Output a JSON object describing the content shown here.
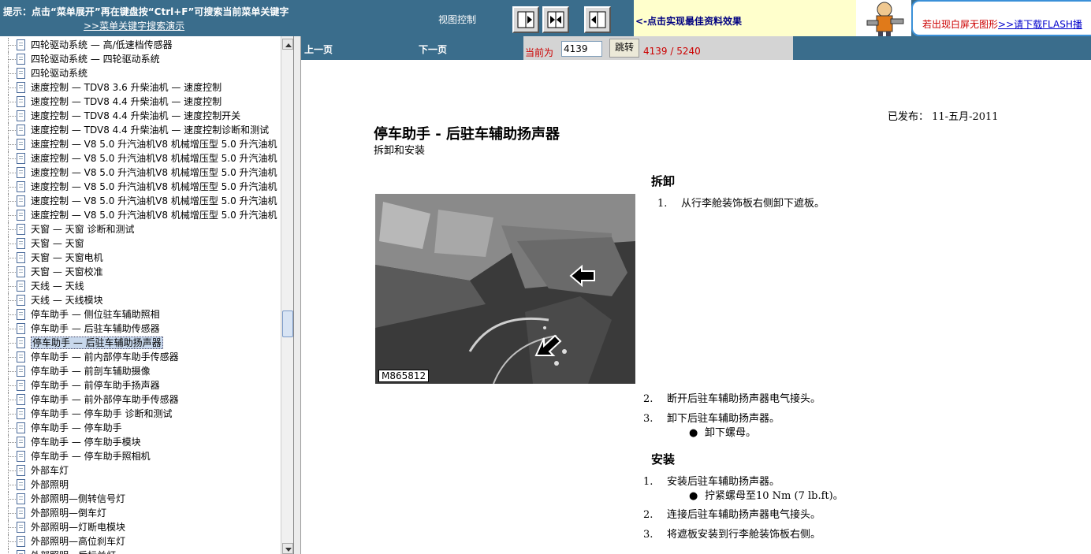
{
  "topbar": {
    "tip": "提示：点击“菜单展开”再在键盘按“Ctrl+F”可搜索当前菜单关键字",
    "tip_link": ">>菜单关键字搜索演示",
    "view_control_label": "视图控制",
    "best_effect": "<-点击实现最佳资料效果",
    "flash_notice": "若出现白屏无图形",
    "flash_link": ">>请下载FLASH播"
  },
  "tree": {
    "items": [
      "四轮驱动系统 — 高/低速档传感器",
      "四轮驱动系统 — 四轮驱动系统",
      "四轮驱动系统",
      "速度控制 — TDV8 3.6 升柴油机 — 速度控制",
      "速度控制 — TDV8 4.4 升柴油机 — 速度控制",
      "速度控制 — TDV8 4.4 升柴油机 — 速度控制开关",
      "速度控制 — TDV8 4.4 升柴油机 — 速度控制诊断和测试",
      "速度控制 — V8 5.0 升汽油机V8 机械增压型 5.0 升汽油机",
      "速度控制 — V8 5.0 升汽油机V8 机械增压型 5.0 升汽油机",
      "速度控制 — V8 5.0 升汽油机V8 机械增压型 5.0 升汽油机",
      "速度控制 — V8 5.0 升汽油机V8 机械增压型 5.0 升汽油机",
      "速度控制 — V8 5.0 升汽油机V8 机械增压型 5.0 升汽油机",
      "速度控制 — V8 5.0 升汽油机V8 机械增压型 5.0 升汽油机",
      "天窗 — 天窗 诊断和测试",
      "天窗 — 天窗",
      "天窗 — 天窗电机",
      "天窗 — 天窗校准",
      "天线 — 天线",
      "天线 — 天线模块",
      "停车助手 — 侧位驻车辅助照相",
      "停车助手 — 后驻车辅助传感器",
      "停车助手 — 后驻车辅助扬声器",
      "停车助手 — 前内部停车助手传感器",
      "停车助手 — 前剖车辅助摄像",
      "停车助手 — 前停车助手扬声器",
      "停车助手 — 前外部停车助手传感器",
      "停车助手 — 停车助手 诊断和测试",
      "停车助手 — 停车助手",
      "停车助手 — 停车助手模块",
      "停车助手 — 停车助手照相机",
      "外部车灯",
      "外部照明",
      "外部照明—侧转信号灯",
      "外部照明—倒车灯",
      "外部照明—灯断电模块",
      "外部照明—高位刹车灯",
      "外部照明—后标兰灯"
    ],
    "selected_index": 21
  },
  "nav": {
    "prev": "上一页",
    "next": "下一页",
    "current_label": "当前为",
    "current_page": "4139",
    "jump": "跳转",
    "page_count": "4139 / 5240"
  },
  "doc": {
    "published": "已发布：  11-五月-2011",
    "title": "停车助手 - 后驻车辅助扬声器",
    "subtitle": "拆卸和安装",
    "figure_label": "M865812",
    "removal_heading": "拆卸",
    "removal_steps": [
      {
        "num": "1.",
        "text": "从行李舱装饰板右侧卸下遮板。"
      },
      {
        "num": "2.",
        "text": "断开后驻车辅助扬声器电气接头。"
      },
      {
        "num": "3.",
        "text": "卸下后驻车辅助扬声器。"
      }
    ],
    "removal_bullet": "卸下螺母。",
    "install_heading": "安装",
    "install_steps": [
      {
        "num": "1.",
        "text": "安装后驻车辅助扬声器。"
      },
      {
        "num": "2.",
        "text": "连接后驻车辅助扬声器电气接头。"
      },
      {
        "num": "3.",
        "text": "将遮板安装到行李舱装饰板右侧。"
      }
    ],
    "install_bullet": "拧紧螺母至10 Nm (7 lb.ft)。"
  }
}
